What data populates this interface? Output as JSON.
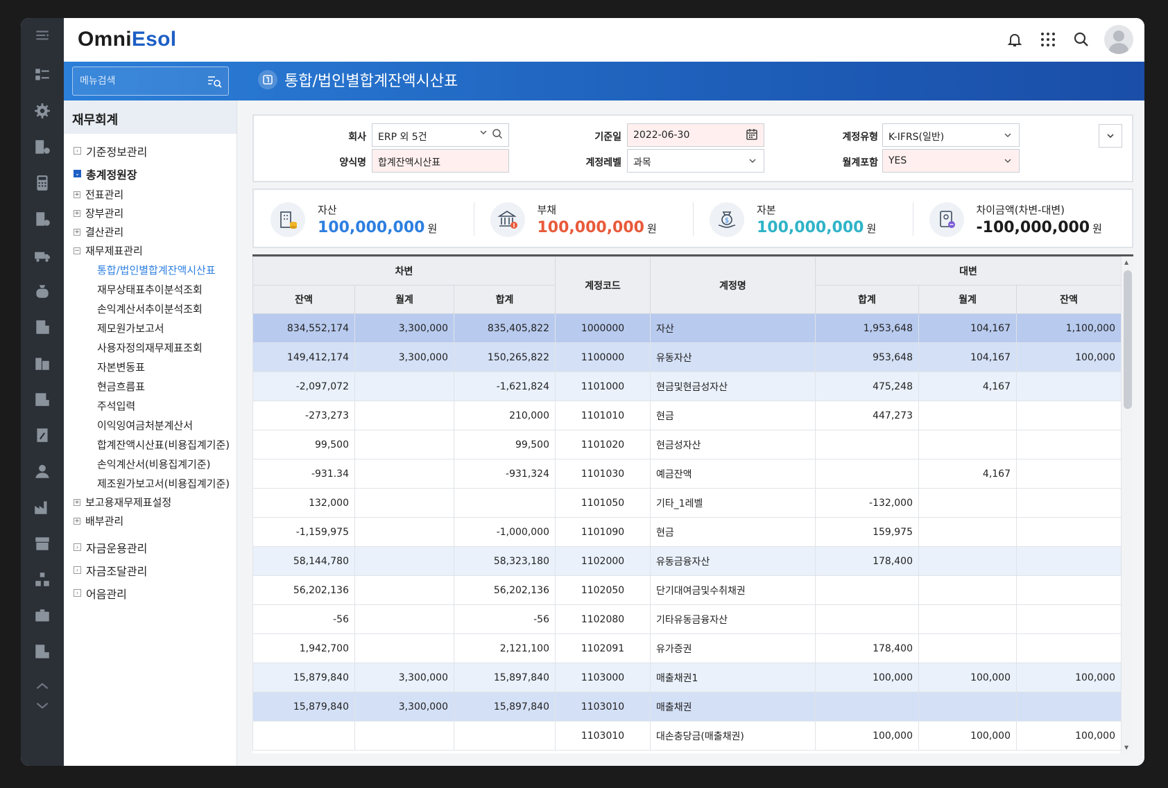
{
  "app": {
    "logo_part1": "Omni",
    "logo_part2": "Esol"
  },
  "search": {
    "placeholder": "메뉴검색"
  },
  "page": {
    "title": "통합/법인별합계잔액시산표"
  },
  "sidebar": {
    "section": "재무회계",
    "items": [
      {
        "label": "기준정보관리"
      },
      {
        "label": "총계정원장"
      },
      {
        "label": "전표관리"
      },
      {
        "label": "장부관리"
      },
      {
        "label": "결산관리"
      },
      {
        "label": "재무제표관리"
      },
      {
        "label": "통합/법인별합계잔액시산표"
      },
      {
        "label": "재무상태표추이분석조회"
      },
      {
        "label": "손익계산서추이분석조회"
      },
      {
        "label": "제모원가보고서"
      },
      {
        "label": "사용자정의재무제표조회"
      },
      {
        "label": "자본변동표"
      },
      {
        "label": "현금흐름표"
      },
      {
        "label": "주석입력"
      },
      {
        "label": "이익잉여금처분계산서"
      },
      {
        "label": "합계잔액시산표(비용집계기준)"
      },
      {
        "label": "손익계산서(비용집계기준)"
      },
      {
        "label": "제조원가보고서(비용집계기준)"
      },
      {
        "label": "보고용재무제표설정"
      },
      {
        "label": "배부관리"
      },
      {
        "label": "자금운용관리"
      },
      {
        "label": "자금조달관리"
      },
      {
        "label": "어음관리"
      }
    ]
  },
  "filter": {
    "company_label": "회사",
    "company_value": "ERP 외 5건",
    "date_label": "기준일",
    "date_value": "2022-06-30",
    "acct_type_label": "계정유형",
    "acct_type_value": "K-IFRS(일반)",
    "form_label": "양식명",
    "form_value": "합계잔액시산표",
    "level_label": "계정레벨",
    "level_value": "과목",
    "monthly_label": "월계포함",
    "monthly_value": "YES"
  },
  "summary": [
    {
      "label": "자산",
      "value": "100,000,000",
      "unit": "원",
      "color": "#2d7fe0"
    },
    {
      "label": "부채",
      "value": "100,000,000",
      "unit": "원",
      "color": "#e85a3a"
    },
    {
      "label": "자본",
      "value": "100,000,000",
      "unit": "원",
      "color": "#2fb3c8"
    },
    {
      "label": "차이금액(차변-대변)",
      "value": "-100,000,000",
      "unit": "원",
      "color": "#1b1b1b"
    }
  ],
  "table": {
    "group_debit": "차변",
    "group_credit": "대변",
    "col_code": "계정코드",
    "col_name": "계정명",
    "debit_cols": [
      "잔액",
      "월계",
      "합계"
    ],
    "credit_cols": [
      "합계",
      "월계",
      "잔액"
    ],
    "rows": [
      {
        "level": 1,
        "cells": [
          "834,552,174",
          "3,300,000",
          "835,405,822",
          "1000000",
          "자산",
          "1,953,648",
          "104,167",
          "1,100,000"
        ]
      },
      {
        "level": 2,
        "cells": [
          "149,412,174",
          "3,300,000",
          "150,265,822",
          "1100000",
          "유동자산",
          "953,648",
          "104,167",
          "100,000"
        ]
      },
      {
        "level": 3,
        "cells": [
          "-2,097,072",
          "",
          "-1,621,824",
          "1101000",
          "현금및현금성자산",
          "475,248",
          "4,167",
          ""
        ]
      },
      {
        "level": 0,
        "cells": [
          "-273,273",
          "",
          "210,000",
          "1101010",
          "현금",
          "447,273",
          "",
          ""
        ]
      },
      {
        "level": 0,
        "cells": [
          "99,500",
          "",
          "99,500",
          "1101020",
          "현금성자산",
          "",
          "",
          ""
        ]
      },
      {
        "level": 0,
        "cells": [
          "-931.34",
          "",
          "-931,324",
          "1101030",
          "예금잔액",
          "",
          "4,167",
          ""
        ]
      },
      {
        "level": 0,
        "cells": [
          "132,000",
          "",
          "",
          "1101050",
          "기타_1레벨",
          "-132,000",
          "",
          ""
        ]
      },
      {
        "level": 0,
        "cells": [
          "-1,159,975",
          "",
          "-1,000,000",
          "1101090",
          "현금",
          "159,975",
          "",
          ""
        ]
      },
      {
        "level": 3,
        "cells": [
          "58,144,780",
          "",
          "58,323,180",
          "1102000",
          "유동금융자산",
          "178,400",
          "",
          ""
        ]
      },
      {
        "level": 0,
        "cells": [
          "56,202,136",
          "",
          "56,202,136",
          "1102050",
          "단기대여금및수취채권",
          "",
          "",
          ""
        ]
      },
      {
        "level": 0,
        "cells": [
          "-56",
          "",
          "-56",
          "1102080",
          "기타유동금융자산",
          "",
          "",
          ""
        ]
      },
      {
        "level": 0,
        "cells": [
          "1,942,700",
          "",
          "2,121,100",
          "1102091",
          "유가증권",
          "178,400",
          "",
          ""
        ]
      },
      {
        "level": 3,
        "cells": [
          "15,879,840",
          "3,300,000",
          "15,897,840",
          "1103000",
          "매출채권1",
          "100,000",
          "100,000",
          "100,000"
        ]
      },
      {
        "level": 2,
        "cells": [
          "15,879,840",
          "3,300,000",
          "15,897,840",
          "1103010",
          "매출채권",
          "",
          "",
          ""
        ]
      },
      {
        "level": 0,
        "cells": [
          "",
          "",
          "",
          "1103010",
          "대손충당금(매출채권)",
          "100,000",
          "100,000",
          "100,000"
        ]
      }
    ]
  }
}
